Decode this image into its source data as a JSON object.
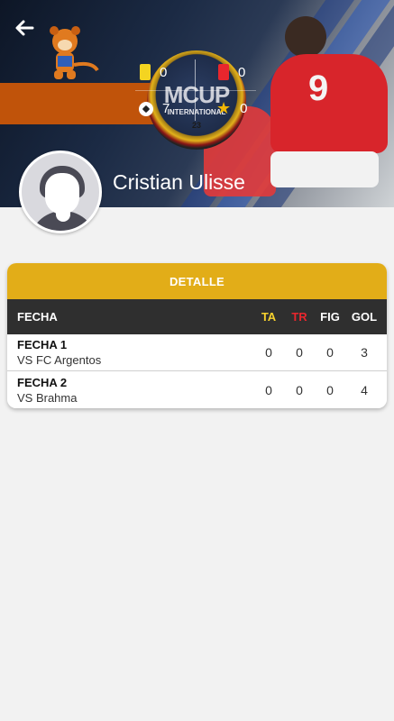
{
  "header": {
    "back_icon": "arrow-left-icon",
    "logo_text": "MCUP",
    "logo_subtext": "INTERNATIONAL",
    "logo_year": "23"
  },
  "stats": {
    "yellow_cards": "0",
    "red_cards": "0",
    "goals": "7",
    "featured": "0"
  },
  "player": {
    "name": "Cristian Ulisse"
  },
  "detail": {
    "title": "DETALLE",
    "columns": {
      "fecha": "FECHA",
      "ta": "TA",
      "tr": "TR",
      "fig": "FIG",
      "gol": "GOL"
    },
    "rows": [
      {
        "fecha": "FECHA 1",
        "rival": "VS FC Argentos",
        "ta": "0",
        "tr": "0",
        "fig": "0",
        "gol": "3"
      },
      {
        "fecha": "FECHA 2",
        "rival": "VS Brahma",
        "ta": "0",
        "tr": "0",
        "fig": "0",
        "gol": "4"
      }
    ]
  },
  "colors": {
    "accent": "#e2ad18",
    "table_header": "#2f2f2f",
    "yellow_card": "#f4d421",
    "red_card": "#e8262d",
    "background": "#f2f2f2"
  }
}
